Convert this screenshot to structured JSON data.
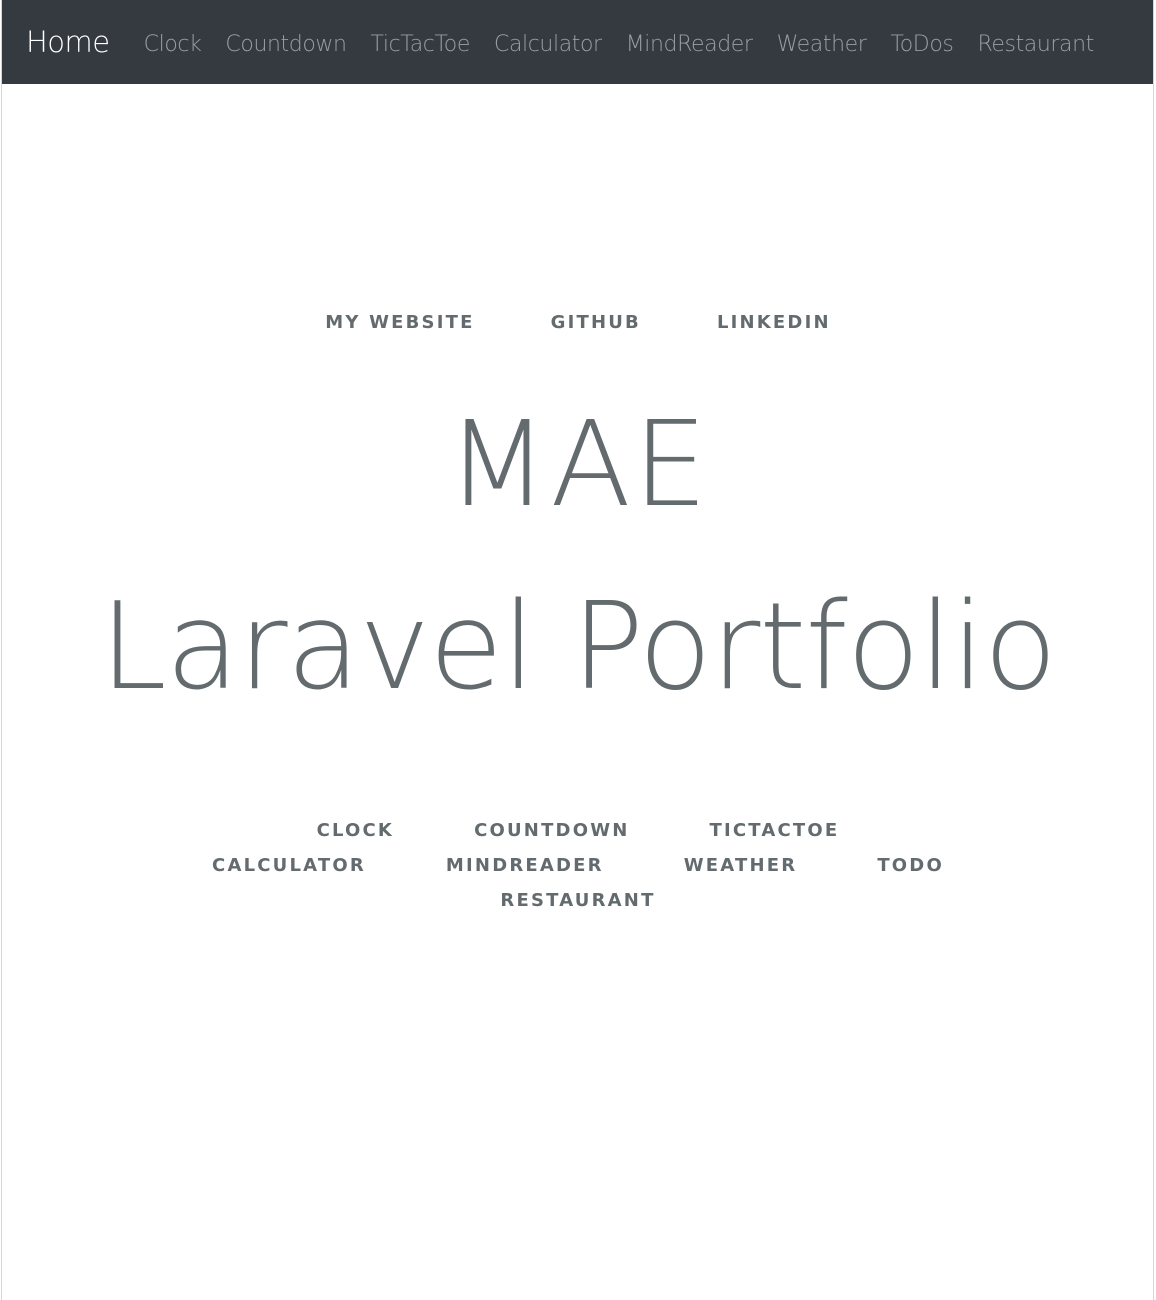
{
  "navbar": {
    "brand": "Home",
    "links": [
      {
        "label": "Clock"
      },
      {
        "label": "Countdown"
      },
      {
        "label": "TicTacToe"
      },
      {
        "label": "Calculator"
      },
      {
        "label": "MindReader"
      },
      {
        "label": "Weather"
      },
      {
        "label": "ToDos"
      },
      {
        "label": "Restaurant"
      }
    ]
  },
  "main": {
    "top_links": [
      {
        "label": "My Website"
      },
      {
        "label": "GitHub"
      },
      {
        "label": "LinkedIn"
      }
    ],
    "title_line1": "MAE",
    "title_line2": "Laravel Portfolio",
    "app_links": [
      {
        "label": "Clock"
      },
      {
        "label": "Countdown"
      },
      {
        "label": "TicTacToe"
      },
      {
        "label": "Calculator"
      },
      {
        "label": "MindReader"
      },
      {
        "label": "Weather"
      },
      {
        "label": "ToDo"
      },
      {
        "label": "Restaurant"
      }
    ]
  },
  "colors": {
    "navbar_bg": "#343a40",
    "brand_text": "#ffffff",
    "nav_link_text": "rgba(255,255,255,0.5)",
    "body_text": "#636b6f"
  }
}
